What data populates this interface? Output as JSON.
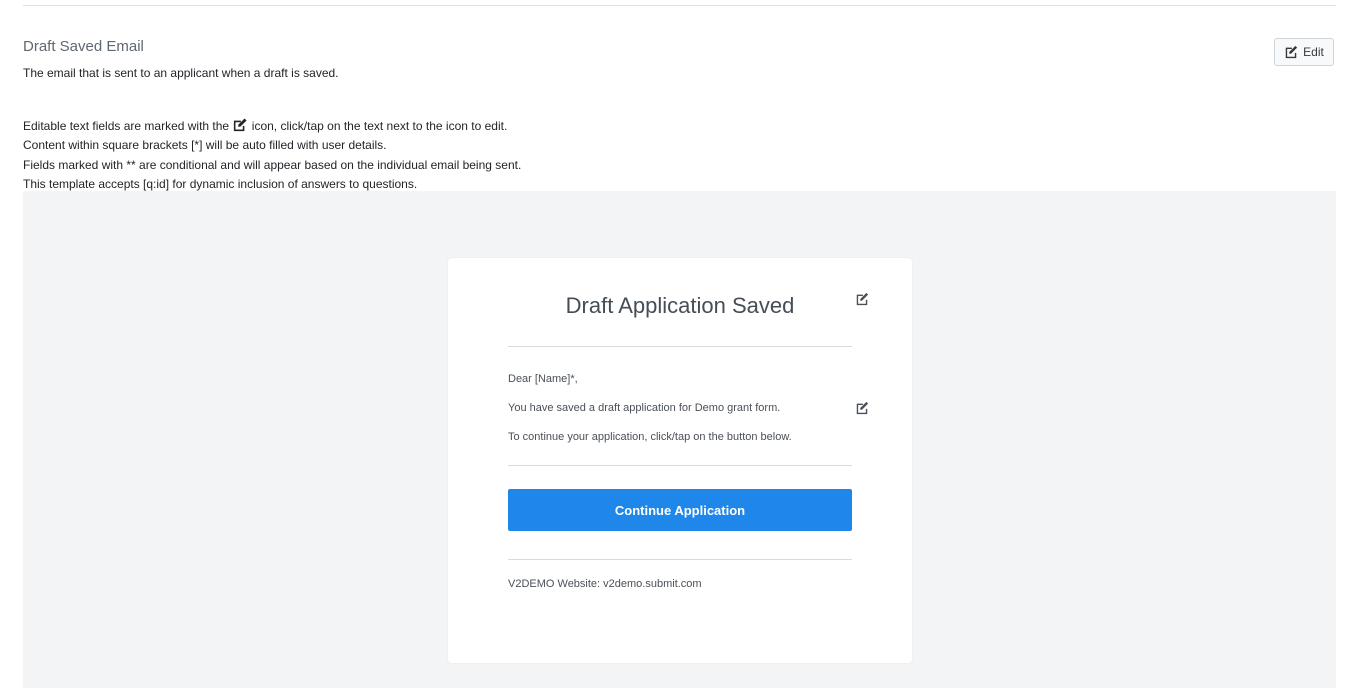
{
  "section": {
    "title": "Draft Saved Email",
    "description": "The email that is sent to an applicant when a draft is saved.",
    "edit_button_label": "Edit"
  },
  "instructions": {
    "line1_before_icon": "Editable text fields are marked with the",
    "line1_after_icon": "icon, click/tap on the text next to the icon to edit.",
    "line2": "Content within square brackets [*] will be auto filled with user details.",
    "line3": "Fields marked with ** are conditional and will appear based on the individual email being sent.",
    "line4": "This template accepts [q:id] for dynamic inclusion of answers to questions."
  },
  "email": {
    "title": "Draft Application Saved",
    "greeting": "Dear [Name]*,",
    "body_line1": "You have saved a draft application for Demo grant form.",
    "body_line2": "To continue your application, click/tap on the button below.",
    "button_label": "Continue Application",
    "footer": "V2DEMO Website: v2demo.submit.com"
  },
  "icons": {
    "edit": "edit-icon"
  },
  "colors": {
    "button_primary": "#1f87ea",
    "preview_background": "#f3f4f6"
  }
}
